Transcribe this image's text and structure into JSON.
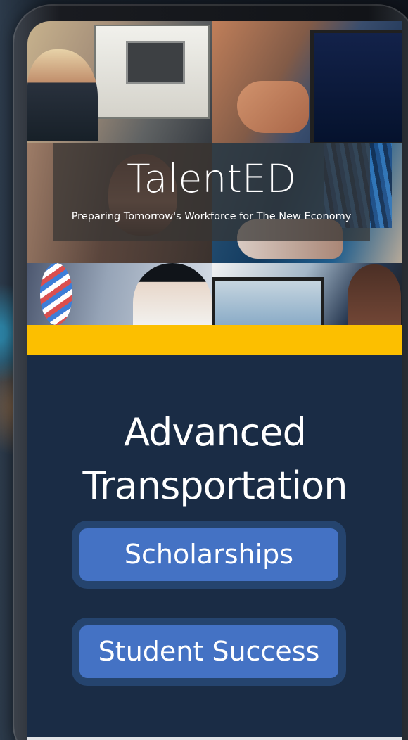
{
  "hero": {
    "title": "TalentED",
    "subtitle": "Preparing Tomorrow's Workforce for The New Economy"
  },
  "colors": {
    "accent": "#fcbf00",
    "panel": "#1a2c45",
    "button": "#4472c4",
    "button_border": "#25446e",
    "text": "#ffffff"
  },
  "main": {
    "heading": "Advanced Transportation",
    "buttons": [
      {
        "label": "Scholarships"
      },
      {
        "label": "Student Success"
      }
    ]
  },
  "icons": {
    "photos": [
      "lab-photo-icon",
      "code-photo-icon",
      "student-photo-icon",
      "cable-photo-icon",
      "dna-lab-photo-icon",
      "computer-photo-icon"
    ]
  }
}
